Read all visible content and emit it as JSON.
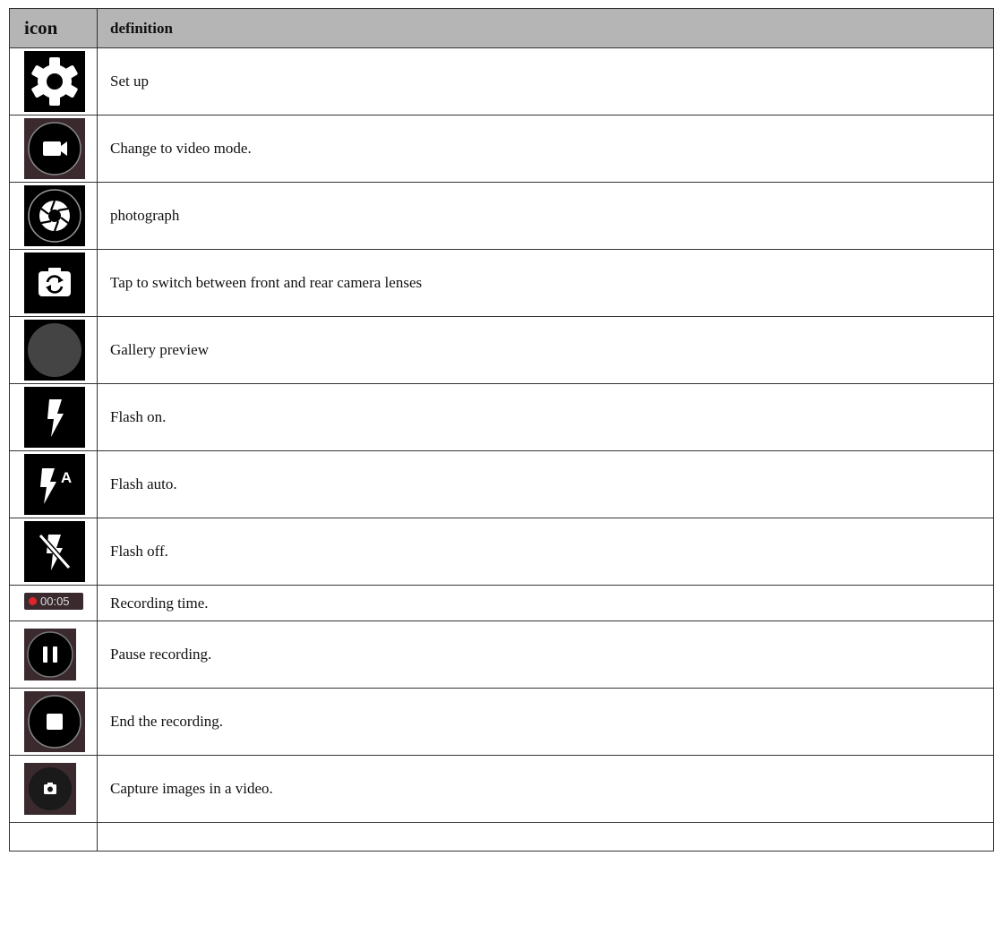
{
  "header": {
    "icon": "icon",
    "definition": "definition"
  },
  "rows": [
    {
      "icon": "gear-icon",
      "definition": "Set up"
    },
    {
      "icon": "video-camera-icon",
      "definition": "Change to video mode."
    },
    {
      "icon": "shutter-icon",
      "definition": "photograph"
    },
    {
      "icon": "camera-switch-icon",
      "definition": "Tap to switch between front and rear camera lenses"
    },
    {
      "icon": "gallery-preview-icon",
      "definition": "Gallery preview"
    },
    {
      "icon": "flash-on-icon",
      "definition": "Flash on."
    },
    {
      "icon": "flash-auto-icon",
      "definition": "Flash auto."
    },
    {
      "icon": "flash-off-icon",
      "definition": "Flash off."
    },
    {
      "icon": "recording-time-icon",
      "definition": "Recording time.",
      "recording_time": "00:05"
    },
    {
      "icon": "pause-icon",
      "definition": "Pause recording."
    },
    {
      "icon": "stop-icon",
      "definition": "End the recording."
    },
    {
      "icon": "capture-icon",
      "definition": "Capture images in a video."
    },
    {
      "icon": "",
      "definition": ""
    }
  ],
  "colors": {
    "header_bg": "#b5b5b5",
    "icon_dark": "#000000",
    "icon_maroon": "#3a2a2e",
    "record_red": "#e0242a"
  }
}
